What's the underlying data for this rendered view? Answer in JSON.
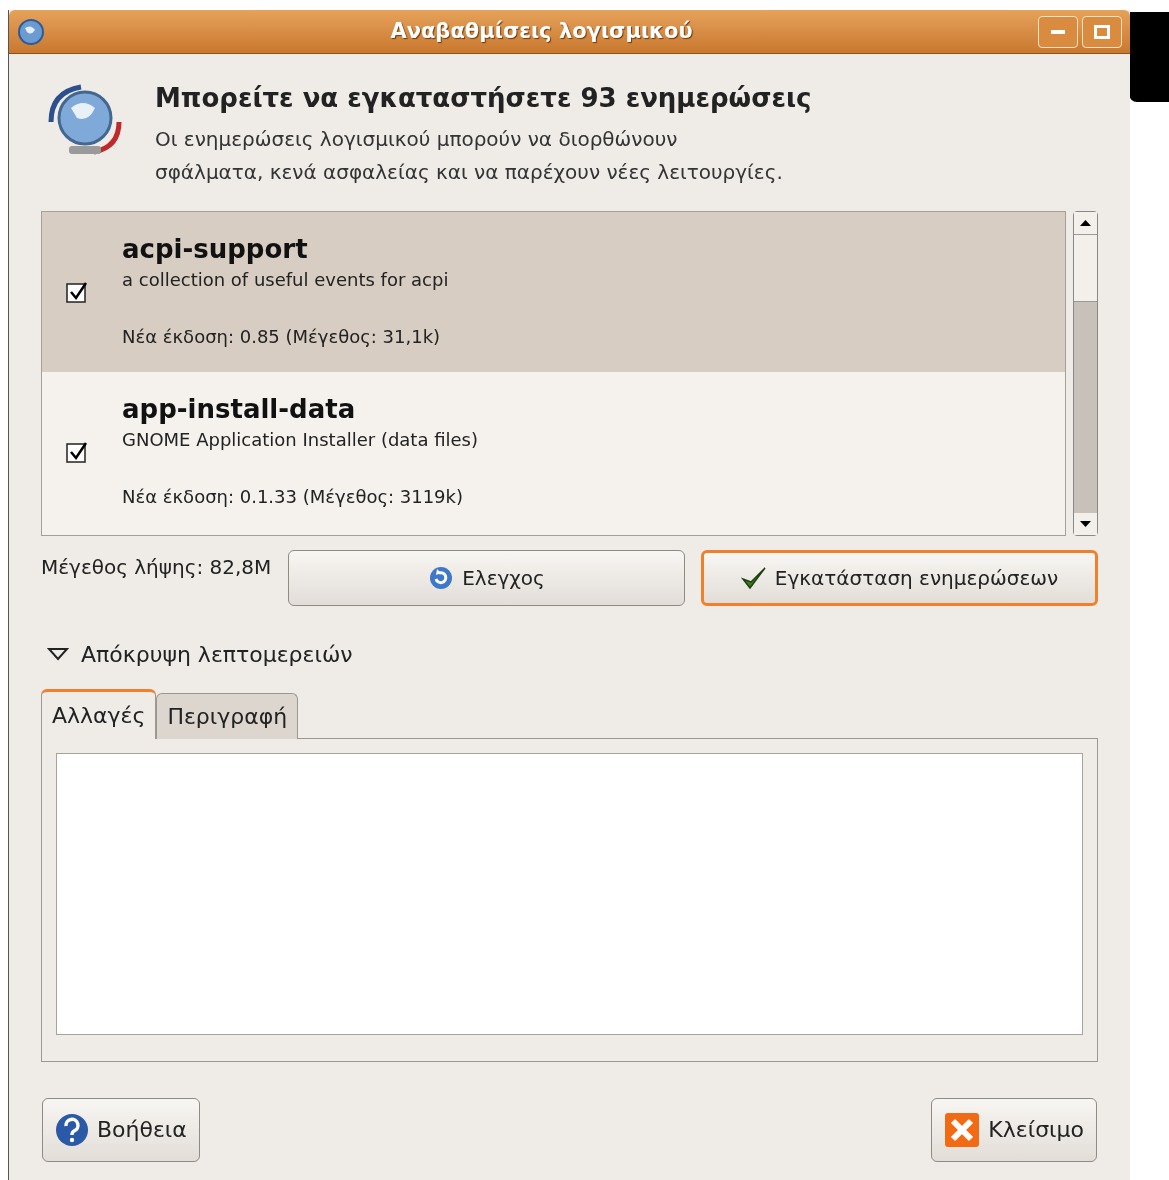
{
  "window": {
    "title": "Αναβαθμίσεις λογισμικού"
  },
  "header": {
    "title": "Μπορείτε να εγκαταστήσετε 93 ενημερώσεις",
    "description": "Οι ενημερώσεις λογισμικού μπορούν να διορθώνουν\nσφάλματα, κενά ασφαλείας και να παρέχουν νέες λειτουργίες."
  },
  "updates": [
    {
      "name": "acpi-support",
      "summary": "a collection of useful events for acpi",
      "version": "Νέα έκδοση: 0.85 (Μέγεθος: 31,1k)",
      "checked": true,
      "selected": true
    },
    {
      "name": "app-install-data",
      "summary": "GNOME Application Installer (data files)",
      "version": "Νέα έκδοση: 0.1.33 (Μέγεθος: 3119k)",
      "checked": true,
      "selected": false
    }
  ],
  "download_size": "Μέγεθος λήψης: 82,8M",
  "buttons": [
    {
      "kind": "check",
      "label": "Ελεγχος",
      "focused": false
    },
    {
      "kind": "install",
      "label": "Εγκατάσταση ενημερώσεων",
      "focused": true
    }
  ],
  "details": {
    "label": "Απόκρυψη λεπτομερειών",
    "expanded": true
  },
  "tabs": [
    {
      "label": "Αλλαγές",
      "selected": true
    },
    {
      "label": "Περιγραφή",
      "selected": false
    }
  ],
  "footer_buttons": [
    {
      "kind": "help",
      "label": "Βοήθεια"
    },
    {
      "kind": "close",
      "label": "Κλείσιμο"
    }
  ]
}
